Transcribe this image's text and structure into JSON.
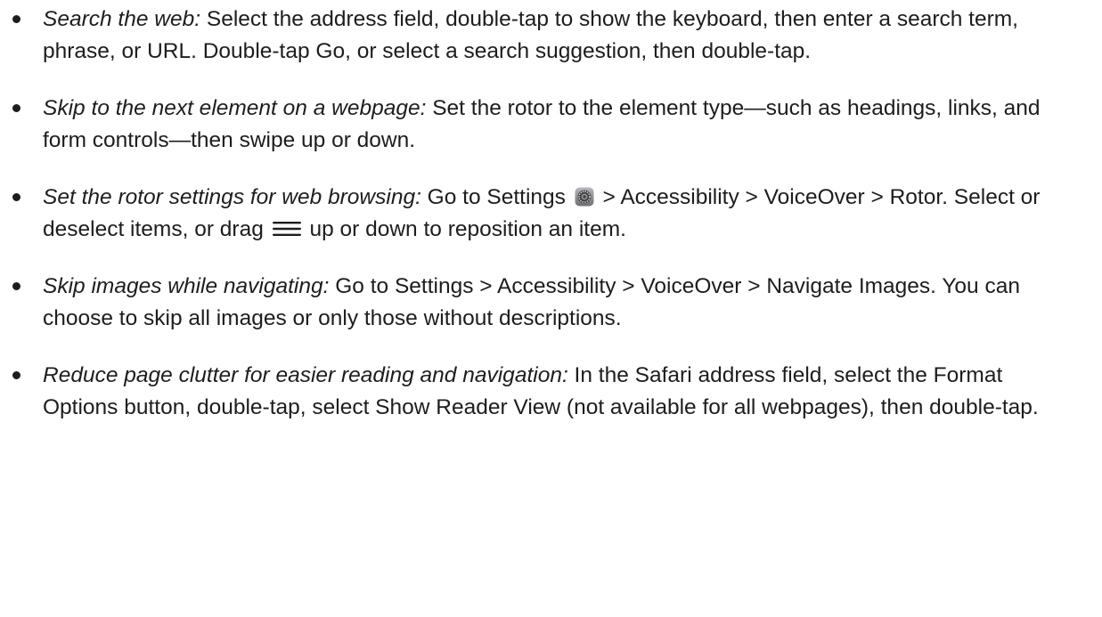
{
  "tips": [
    {
      "topic": "Search the web:",
      "text": " Select the address field, double-tap to show the keyboard, then enter a search term, phrase, or URL. Double-tap Go, or select a search suggestion, then double-tap."
    },
    {
      "topic": "Skip to the next element on a webpage:",
      "text": " Set the rotor to the element type—such as headings, links, and form controls—then swipe up or down."
    },
    {
      "topic": "Set the rotor settings for web browsing:",
      "text_before_settings_icon": " Go to Settings ",
      "settings_icon": "settings-gear-icon",
      "text_between_icons": " > Accessibility > VoiceOver > Rotor. Select or deselect items, or drag ",
      "drag_icon": "reorder-handle-icon",
      "text_after_drag_icon": " up or down to reposition an item."
    },
    {
      "topic": "Skip images while navigating:",
      "text": " Go to Settings > Accessibility > VoiceOver > Navigate Images. You can choose to skip all images or only those without descriptions."
    },
    {
      "topic": "Reduce page clutter for easier reading and navigation:",
      "text": " In the Safari address field, select the Format Options button, double-tap, select Show Reader View (not available for all webpages), then double-tap."
    }
  ]
}
